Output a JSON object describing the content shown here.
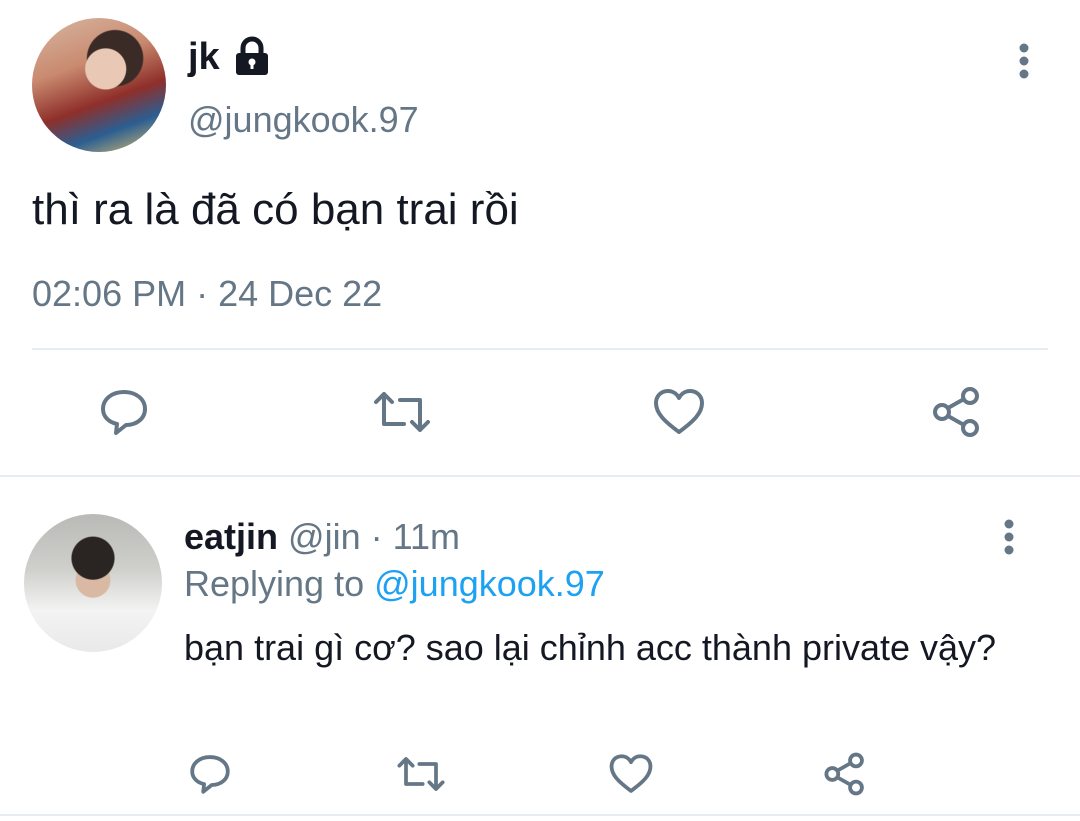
{
  "main_tweet": {
    "display_name": "jk",
    "handle": "@jungkook.97",
    "text": "thì ra là đã có bạn trai rồi",
    "timestamp": "02:06 PM · 24 Dec 22"
  },
  "reply": {
    "display_name": "eatjin",
    "meta": "@jin · 11m",
    "replying_prefix": "Replying to",
    "replying_to": "@jungkook.97",
    "text": "bạn trai gì cơ? sao lại chỉnh acc thành private vậy?"
  },
  "icons": {
    "lock": "lock-icon",
    "more": "more-vertical-icon",
    "reply": "reply-icon",
    "retweet": "retweet-icon",
    "like": "heart-icon",
    "share": "share-icon"
  },
  "colors": {
    "text": "#141823",
    "secondary": "#657786",
    "link": "#1da1f2",
    "divider": "#e6ecf0"
  }
}
